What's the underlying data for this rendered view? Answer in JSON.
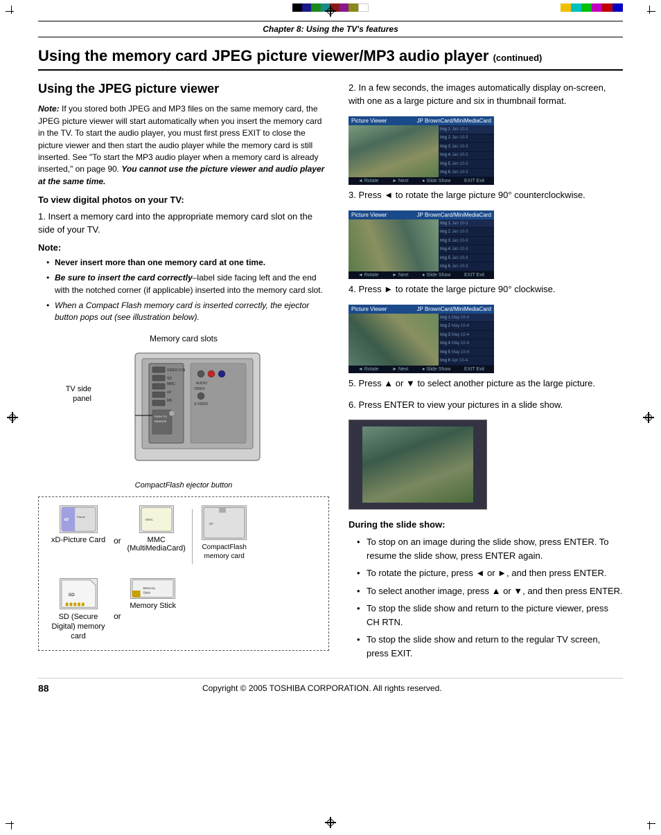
{
  "page": {
    "chapter_header": "Chapter 8: Using the TV's features",
    "main_title": "Using the memory card JPEG picture viewer/MP3 audio player",
    "continued_label": "(continued)",
    "section_title": "Using the JPEG picture viewer",
    "page_number": "88",
    "copyright": "Copyright © 2005 TOSHIBA CORPORATION. All rights reserved."
  },
  "left_col": {
    "note_intro": "Note:",
    "note_text": "If you stored both JPEG and MP3 files on the same memory card, the JPEG picture viewer will start automatically when you insert the memory card in the TV. To start the audio player, you must first press EXIT to close the picture viewer and then start the audio player while the memory card is still inserted. See \"To start the MP3 audio player when a memory card is already inserted,\" on page 90.",
    "bold_warning": "You cannot use the picture viewer and audio player at the same time.",
    "to_view_heading": "To view digital photos on your TV:",
    "step1": "1.",
    "step1_text": "Insert a memory card into the appropriate memory card slot on the side of your TV.",
    "note2_label": "Note:",
    "bullet1": "Never insert more than one memory card at one time.",
    "bullet2_part1": "Be sure to insert the card correctly",
    "bullet2_part2": "–label side facing left and the end with the notched corner (if applicable) inserted into the memory card slot.",
    "bullet3": "When a Compact Flash memory card is inserted correctly, the ejector button pops out (see illustration below).",
    "diagram_label": "Memory card slots",
    "tv_side_label": "TV side panel",
    "compactflash_label": "CompactFlash ejector button",
    "card_xd_label": "xD-Picture Card",
    "card_mmc_label": "MMC (MultiMediaCard)",
    "card_compactflash_label": "CompactFlash memory card",
    "card_sd_label": "SD (Secure Digital) memory card",
    "card_memorystick_label": "Memory Stick",
    "or_label": "or"
  },
  "right_col": {
    "step2_num": "2.",
    "step2_text": "In a few seconds, the images automatically display on-screen, with one as a large picture and six in thumbnail format.",
    "step3_num": "3.",
    "step3_text": "Press ◄ to rotate the large picture 90° counterclockwise.",
    "step4_num": "4.",
    "step4_text": "Press ► to rotate the large picture 90° clockwise.",
    "step5_num": "5.",
    "step5_text": "Press ▲ or ▼ to select another picture as the large picture.",
    "step6_num": "6.",
    "step6_text": "Press ENTER to view your pictures in a slide show.",
    "during_heading": "During the slide show:",
    "during1": "To stop on an image during the slide show, press ENTER. To resume the slide show, press ENTER again.",
    "during2": "To rotate the picture, press ◄ or ►, and then press ENTER.",
    "during3": "To select another image, press ▲ or ▼, and then press ENTER.",
    "during4": "To stop the slide show and return to the picture viewer, press CH RTN.",
    "during5": "To stop the slide show and return to the regular TV screen, press EXIT.",
    "ss_title1": "Picture Viewer",
    "ss_brand1": "JP BrownCard/MiniMediaCard",
    "ss_labels": [
      "Rotate",
      "Next",
      "Slide Show",
      "Exit"
    ],
    "ss_thumb_texts": [
      "Img 1-3",
      "Img 2-3",
      "Img 3-3",
      "Img 4-3",
      "Img 5-3",
      "Img 6-3"
    ]
  },
  "colors": {
    "accent": "#000000",
    "ss_bar_bg": "#1a4a8a",
    "ss_main_bg": "#1a3060",
    "ss_thumb_bg": "#132040"
  }
}
